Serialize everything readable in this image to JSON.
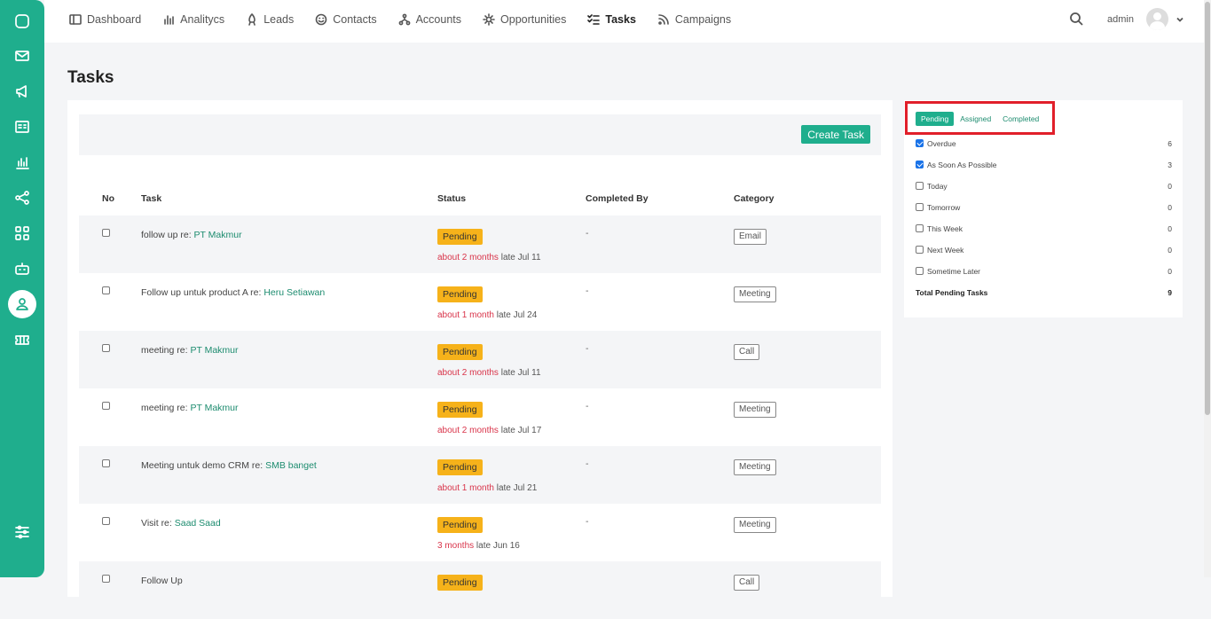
{
  "topnav": {
    "items": [
      {
        "label": "Dashboard",
        "icon": "dashboard-icon"
      },
      {
        "label": "Analitycs",
        "icon": "bar-chart-icon"
      },
      {
        "label": "Leads",
        "icon": "rocket-icon"
      },
      {
        "label": "Contacts",
        "icon": "smile-icon"
      },
      {
        "label": "Accounts",
        "icon": "network-icon"
      },
      {
        "label": "Opportunities",
        "icon": "sun-icon"
      },
      {
        "label": "Tasks",
        "icon": "tasks-icon",
        "active": true
      },
      {
        "label": "Campaigns",
        "icon": "rss-icon"
      }
    ],
    "user": "admin"
  },
  "page": {
    "title": "Tasks",
    "create_button": "Create Task"
  },
  "table": {
    "headers": [
      "No",
      "Task",
      "Status",
      "Completed By",
      "Category"
    ],
    "rows": [
      {
        "task": "follow up re: ",
        "link": "PT Makmur",
        "status": "Pending",
        "due_rel": "about 2 months",
        "due_rest": " late Jul 11",
        "completed_by": "-",
        "category": "Email"
      },
      {
        "task": "Follow up untuk product A re: ",
        "link": "Heru Setiawan",
        "status": "Pending",
        "due_rel": "about 1 month",
        "due_rest": " late Jul 24",
        "completed_by": "-",
        "category": "Meeting"
      },
      {
        "task": "meeting re: ",
        "link": "PT Makmur",
        "status": "Pending",
        "due_rel": "about 2 months",
        "due_rest": " late Jul 11",
        "completed_by": "-",
        "category": "Call"
      },
      {
        "task": "meeting re: ",
        "link": "PT Makmur",
        "status": "Pending",
        "due_rel": "about 2 months",
        "due_rest": " late Jul 17",
        "completed_by": "-",
        "category": "Meeting"
      },
      {
        "task": "Meeting untuk demo CRM re: ",
        "link": "SMB banget",
        "status": "Pending",
        "due_rel": "about 1 month",
        "due_rest": " late Jul 21",
        "completed_by": "-",
        "category": "Meeting"
      },
      {
        "task": "Visit re: ",
        "link": "Saad Saad",
        "status": "Pending",
        "due_rel": "3 months",
        "due_rest": " late Jun 16",
        "completed_by": "-",
        "category": "Meeting"
      },
      {
        "task": "Follow Up",
        "link": "",
        "status": "Pending",
        "due_rel": "",
        "due_rest": "",
        "completed_by": "",
        "category": "Call"
      }
    ]
  },
  "summary": {
    "tabs": [
      "Pending",
      "Assigned",
      "Completed"
    ],
    "items": [
      {
        "label": "Overdue",
        "count": "6",
        "checked": true
      },
      {
        "label": "As Soon As Possible",
        "count": "3",
        "checked": true
      },
      {
        "label": "Today",
        "count": "0",
        "checked": false
      },
      {
        "label": "Tomorrow",
        "count": "0",
        "checked": false
      },
      {
        "label": "This Week",
        "count": "0",
        "checked": false
      },
      {
        "label": "Next Week",
        "count": "0",
        "checked": false
      },
      {
        "label": "Sometime Later",
        "count": "0",
        "checked": false
      }
    ],
    "total_label": "Total Pending Tasks",
    "total_count": "9"
  },
  "colors": {
    "accent": "#1fae8d",
    "pending": "#f6b21a",
    "overdue": "#d9344a",
    "highlight": "#e11f2a"
  }
}
